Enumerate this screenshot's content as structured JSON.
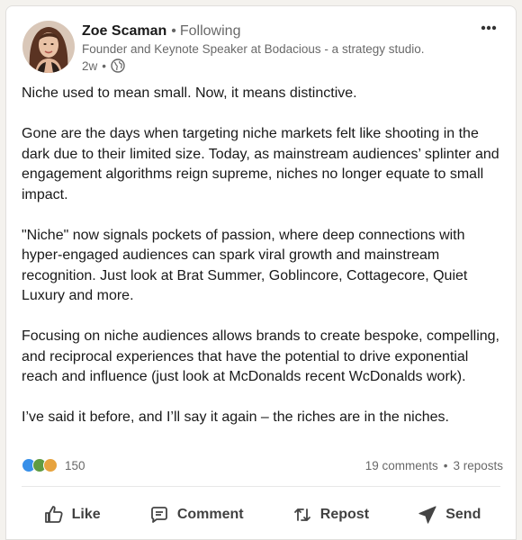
{
  "author": {
    "name": "Zoe Scaman",
    "follow_status": "Following",
    "separator": "•",
    "headline": "Founder and Keynote Speaker at Bodacious - a strategy studio.",
    "time_ago": "2w",
    "visibility_icon": "globe-icon"
  },
  "post": {
    "paragraphs": [
      "Niche used to mean small. Now, it means distinctive.",
      "Gone are the days when targeting niche markets felt like shooting in the dark due to their limited size. Today, as mainstream audiences’ splinter and engagement algorithms reign supreme, niches no longer equate to small impact.",
      "\"Niche\" now signals pockets of passion, where deep connections with hyper-engaged audiences can spark viral growth and mainstream recognition. Just look at Brat Summer, Goblincore, Cottagecore, Quiet Luxury and more.",
      "Focusing on niche audiences allows brands to create bespoke, compelling, and reciprocal experiences that have the potential to drive exponential reach and influence (just look at McDonalds recent WcDonalds work).",
      "I’ve said it before, and I’ll say it again – the riches are in the niches."
    ]
  },
  "social": {
    "reaction_count": "150",
    "reaction_icons": [
      "like-reaction-icon",
      "celebrate-reaction-icon",
      "insightful-reaction-icon"
    ],
    "comments": "19 comments",
    "separator": "•",
    "reposts": "3 reposts"
  },
  "actions": {
    "like": "Like",
    "comment": "Comment",
    "repost": "Repost",
    "send": "Send"
  },
  "colors": {
    "like_reaction": "#378fe9",
    "celebrate_reaction": "#5f9b41",
    "insight_reaction": "#e7a33e"
  }
}
